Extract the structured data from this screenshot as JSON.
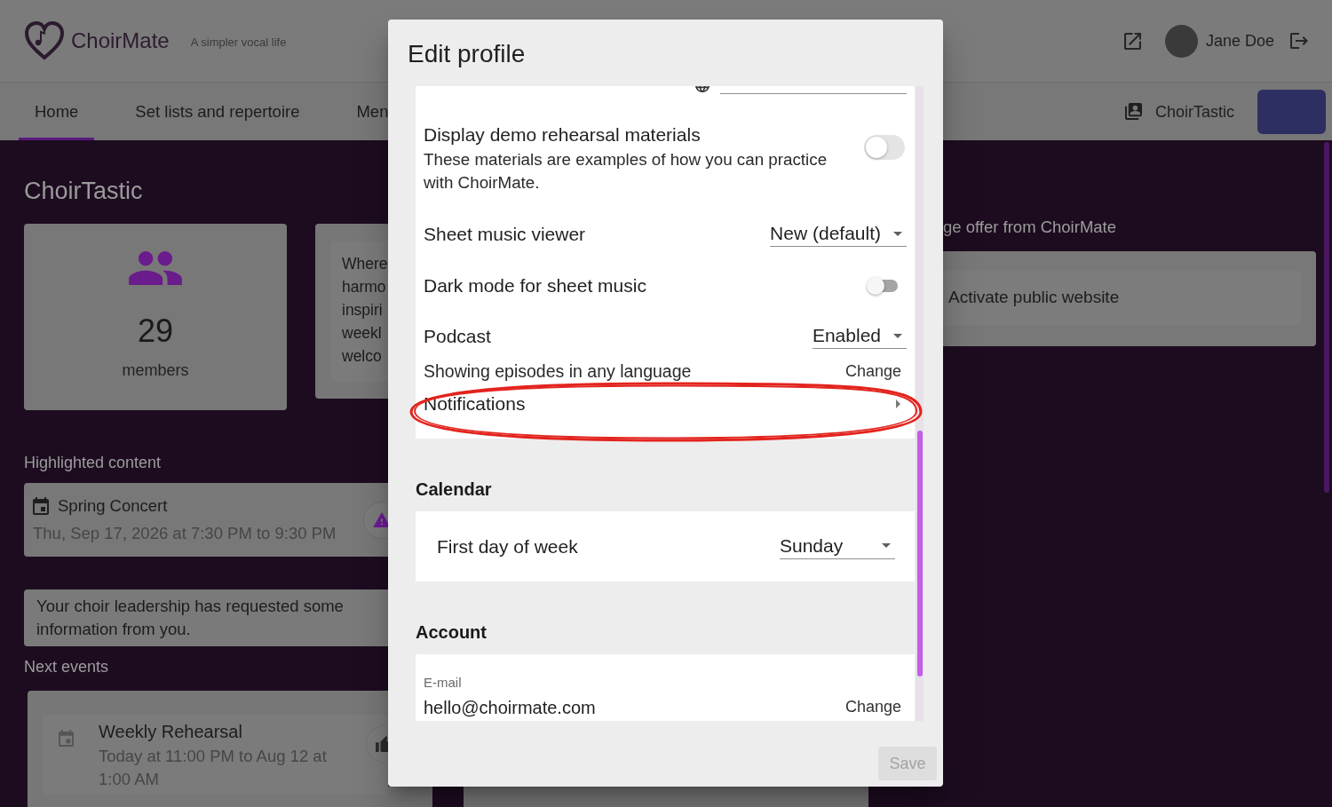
{
  "header": {
    "brand": "ChoirMate",
    "tagline": "A simpler vocal life",
    "user_name": "Jane Doe"
  },
  "nav": {
    "tabs": [
      {
        "label": "Home",
        "selected": true
      },
      {
        "label": "Set lists and repertoire",
        "selected": false
      },
      {
        "label": "Men",
        "selected": false
      }
    ],
    "choir_name": "ChoirTastic"
  },
  "main": {
    "title": "ChoirTastic",
    "members": {
      "count": "29",
      "label": "members"
    },
    "about_text_lines": [
      "Where",
      "harmo",
      "inspiri",
      "weekl",
      "welco"
    ],
    "highlighted": {
      "heading": "Highlighted content",
      "event": {
        "title": "Spring Concert",
        "time": "Thu, Sep 17, 2026 at 7:30 PM to 9:30 PM"
      }
    },
    "request_notice": "Your choir leadership has requested some information from you.",
    "next_events": {
      "heading": "Next events",
      "events": [
        {
          "title": "Weekly Rehearsal",
          "time": "Today at 11:00 PM to Aug 12 at 1:00 AM"
        }
      ]
    }
  },
  "offer": {
    "heading": "ge offer from ChoirMate",
    "items": [
      "Activate public website"
    ]
  },
  "dialog": {
    "title": "Edit profile",
    "sections": [
      {
        "rows": [
          {
            "kind": "language",
            "highlighted": false
          },
          {
            "kind": "toggle",
            "label": "Display demo rehearsal materials",
            "description": "These materials are examples of how you can practice with ChoirMate.",
            "on": false,
            "highlighted": false
          },
          {
            "kind": "select",
            "label": "Sheet music viewer",
            "value": "New (default)",
            "highlighted": false
          },
          {
            "kind": "switch",
            "label": "Dark mode for sheet music",
            "on": false,
            "highlighted": false
          },
          {
            "kind": "select",
            "label": "Podcast",
            "value": "Enabled",
            "note": "Showing episodes in any language",
            "action": "Change",
            "highlighted": false
          },
          {
            "kind": "link",
            "label": "Notifications",
            "highlighted": true
          }
        ]
      },
      {
        "heading": "Calendar",
        "rows": [
          {
            "kind": "select",
            "label": "First day of week",
            "value": "Sunday",
            "highlighted": false
          }
        ]
      },
      {
        "heading": "Account",
        "rows": [
          {
            "kind": "field",
            "label": "E-mail",
            "value": "hello@choirmate.com",
            "action": "Change",
            "highlighted": false
          }
        ]
      }
    ],
    "save": {
      "label": "Save",
      "disabled": true
    }
  }
}
